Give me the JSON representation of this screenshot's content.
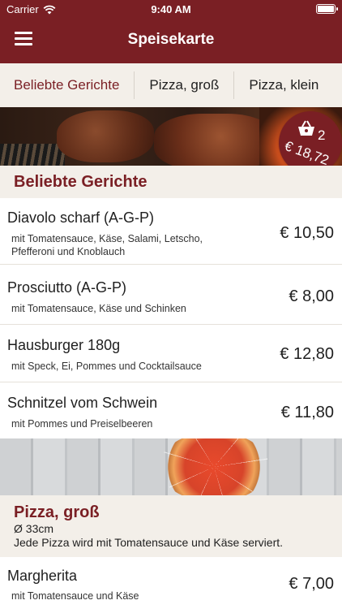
{
  "status_bar": {
    "carrier": "Carrier",
    "time": "9:40 AM"
  },
  "header": {
    "title": "Speisekarte"
  },
  "tabs": [
    {
      "label": "Beliebte Gerichte"
    },
    {
      "label": "Pizza, groß"
    },
    {
      "label": "Pizza, klein"
    }
  ],
  "cart": {
    "count": "2",
    "total": "€ 18,72"
  },
  "sections": {
    "popular": {
      "title": "Beliebte Gerichte",
      "items": [
        {
          "name": "Diavolo scharf (A-G-P)",
          "desc": "mit Tomatensauce, Käse, Salami, Letscho, Pfefferoni und Knoblauch",
          "price": "€ 10,50"
        },
        {
          "name": "Prosciutto (A-G-P)",
          "desc": "mit Tomatensauce, Käse und Schinken",
          "price": "€ 8,00"
        },
        {
          "name": "Hausburger 180g",
          "desc": "mit Speck, Ei, Pommes und Cocktailsauce",
          "price": "€ 12,80"
        },
        {
          "name": "Schnitzel vom Schwein",
          "desc": "mit Pommes und Preiselbeeren",
          "price": "€ 11,80"
        }
      ]
    },
    "pizza_large": {
      "title": "Pizza, groß",
      "size": "Ø 33cm",
      "note": "Jede Pizza wird mit Tomatensauce und Käse serviert.",
      "items": [
        {
          "name": "Margherita",
          "desc": "mit Tomatensauce und Käse",
          "price": "€ 7,00"
        }
      ]
    }
  },
  "colors": {
    "brand": "#7a1f24",
    "section_bg": "#f3efe9"
  }
}
